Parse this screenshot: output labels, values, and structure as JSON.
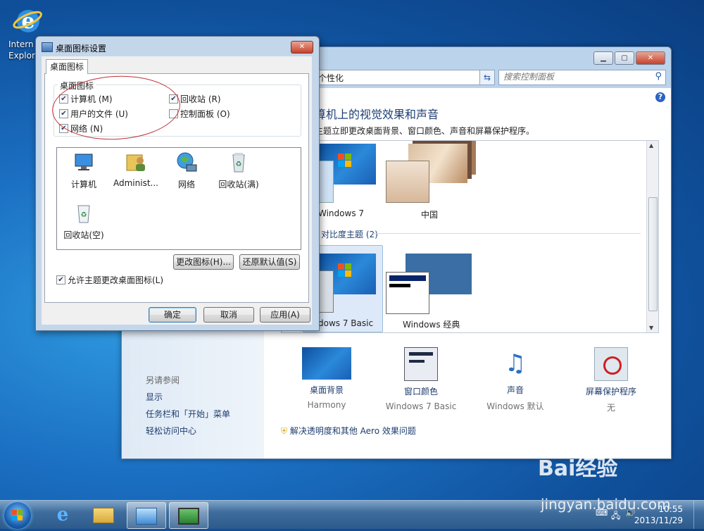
{
  "desktop": {
    "ie_label_line1": "Intern",
    "ie_label_line2": "Explor"
  },
  "control_panel": {
    "breadcrumb": "个性化",
    "search_placeholder": "搜索控制面板",
    "heading": "算机上的视觉效果和声音",
    "subheading": "主题立即更改桌面背景、窗口颜色、声音和屏幕保护程序。",
    "themes": [
      {
        "label": "Windows 7"
      },
      {
        "label": "中国"
      }
    ],
    "high_contrast_label": "对比度主题 (2)",
    "basic_themes": [
      {
        "label": "dows 7 Basic"
      },
      {
        "label": "Windows 经典"
      }
    ],
    "see_also": "另请参阅",
    "left_links": [
      "显示",
      "任务栏和「开始」菜单",
      "轻松访问中心"
    ],
    "bottom_items": [
      {
        "label": "桌面背景",
        "value": "Harmony"
      },
      {
        "label": "窗口颜色",
        "value": "Windows 7 Basic"
      },
      {
        "label": "声音",
        "value": "Windows 默认"
      },
      {
        "label": "屏幕保护程序",
        "value": "无"
      }
    ],
    "aero_link": "解决透明度和其他 Aero 效果问题"
  },
  "dialog": {
    "title": "桌面图标设置",
    "tab": "桌面图标",
    "group_label": "桌面图标",
    "checkboxes": [
      {
        "label": "计算机 (M)",
        "checked": true
      },
      {
        "label": "回收站 (R)",
        "checked": true
      },
      {
        "label": "用户的文件 (U)",
        "checked": true
      },
      {
        "label": "控制面板 (O)",
        "checked": false
      },
      {
        "label": "网络 (N)",
        "checked": true
      }
    ],
    "icons": [
      "计算机",
      "Administ...",
      "网络",
      "回收站(满)",
      "回收站(空)"
    ],
    "change_icon_btn": "更改图标(H)...",
    "restore_btn": "还原默认值(S)",
    "allow_themes": "允许主题更改桌面图标(L)",
    "ok": "确定",
    "cancel": "取消",
    "apply": "应用(A)"
  },
  "taskbar": {
    "time": "10:55",
    "date": "2013/11/29"
  },
  "watermark": {
    "brand": "Bai经验",
    "url": "jingyan.baidu.com"
  }
}
